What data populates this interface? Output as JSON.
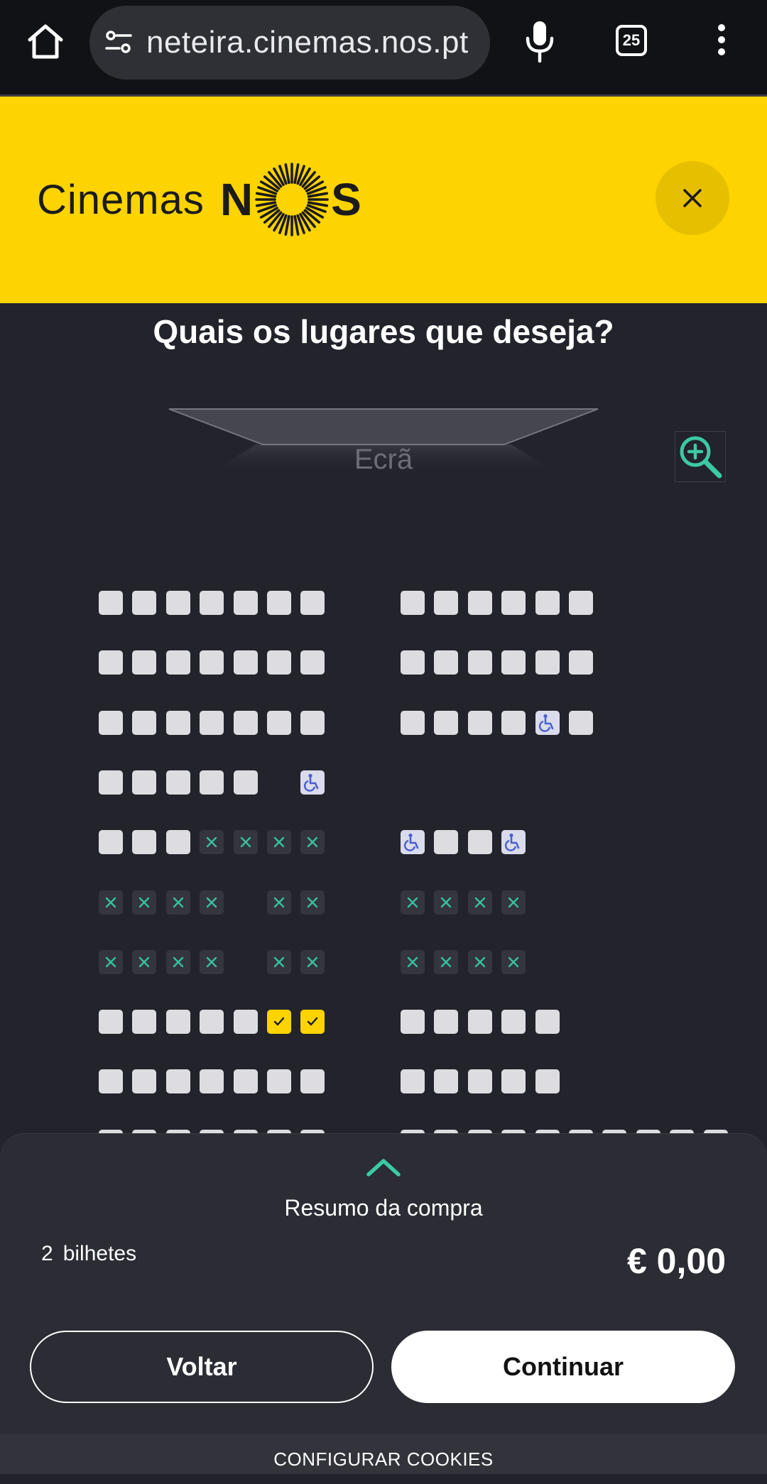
{
  "browser": {
    "url": "neteira.cinemas.nos.pt",
    "tab_count": "25",
    "icons": [
      "home-icon",
      "site-settings-icon",
      "mic-icon",
      "tabs-icon",
      "more-icon"
    ]
  },
  "header": {
    "logo_word1": "Cinemas",
    "logo_n": "N",
    "logo_s": "S",
    "brand_color": "#fdd300"
  },
  "title": "Quais os lugares que deseja?",
  "screen_label": "Ecrã",
  "seat_legend_colors": {
    "available": "#dddde1",
    "occupied": "#34353d",
    "selected": "#fdd300",
    "occupied_mark": "#39c0a0",
    "wheelchair_icon": "#4a5fd0"
  },
  "seat_rows": [
    {
      "left": "AAAAAAA",
      "right": "AAAAAA"
    },
    {
      "left": "AAAAAAA",
      "right": "AAAAAA"
    },
    {
      "left": "AAAAAAA",
      "right": "AAAAWA"
    },
    {
      "left": "AAAAA.W",
      "right": ""
    },
    {
      "left": "AAAXXXX",
      "right": "WAAW"
    },
    {
      "left": "XXXX.XX",
      "right": "XXXX"
    },
    {
      "left": "XXXX.XX",
      "right": "XXXX"
    },
    {
      "left": "AAAAASS",
      "right": "AAAAA"
    },
    {
      "left": "AAAAAAA",
      "right": "AAAAA"
    },
    {
      "left": "AAAAAAA",
      "right": "AAAAAAAAAA"
    }
  ],
  "summary": {
    "title": "Resumo da compra",
    "ticket_count": "2",
    "ticket_label": "bilhetes",
    "price": "€ 0,00"
  },
  "buttons": {
    "back": "Voltar",
    "continue": "Continuar"
  },
  "cookies": "CONFIGURAR COOKIES"
}
